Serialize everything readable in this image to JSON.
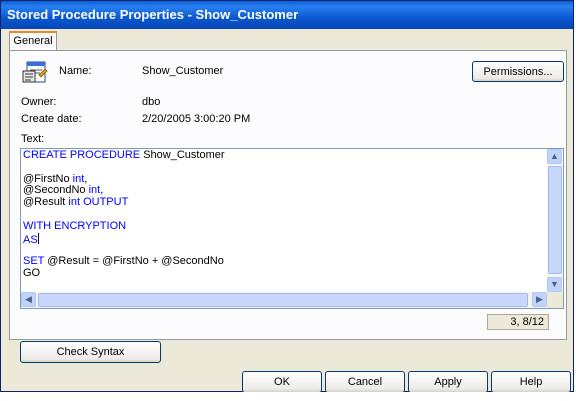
{
  "window": {
    "title": "Stored Procedure Properties - Show_Customer"
  },
  "tabs": [
    {
      "label": "General"
    }
  ],
  "properties": {
    "name_label": "Name:",
    "name_value": "Show_Customer",
    "owner_label": "Owner:",
    "owner_value": "dbo",
    "create_date_label": "Create date:",
    "create_date_value": "2/20/2005 3:00:20 PM",
    "text_label": "Text:"
  },
  "buttons": {
    "permissions": "Permissions...",
    "check_syntax": "Check Syntax",
    "ok": "OK",
    "cancel": "Cancel",
    "apply": "Apply",
    "help": "Help"
  },
  "code": {
    "lines": [
      [
        {
          "t": "CREATE PROCEDURE ",
          "kw": true
        },
        {
          "t": "Show_Customer",
          "kw": false
        }
      ],
      [],
      [
        {
          "t": "@FirstNo ",
          "kw": false
        },
        {
          "t": "int",
          "kw": true
        },
        {
          "t": ",",
          "kw": false
        }
      ],
      [
        {
          "t": "@SecondNo ",
          "kw": false
        },
        {
          "t": "int",
          "kw": true
        },
        {
          "t": ",",
          "kw": false
        }
      ],
      [
        {
          "t": "@Result ",
          "kw": false
        },
        {
          "t": "int OUTPUT",
          "kw": true
        }
      ],
      [],
      [
        {
          "t": "WITH ENCRYPTION",
          "kw": true
        }
      ],
      [
        {
          "t": "AS",
          "kw": true
        }
      ],
      [],
      [
        {
          "t": "SET ",
          "kw": true
        },
        {
          "t": "@Result = @FirstNo + @SecondNo",
          "kw": false
        }
      ],
      [
        {
          "t": "GO",
          "kw": false
        }
      ]
    ],
    "caret_line": 7
  },
  "status": {
    "position": "3, 8/12"
  },
  "colors": {
    "keyword": "#0000ff",
    "titlebar": "#0a5fd8"
  },
  "icons": {
    "procedure": "stored-procedure-icon"
  }
}
